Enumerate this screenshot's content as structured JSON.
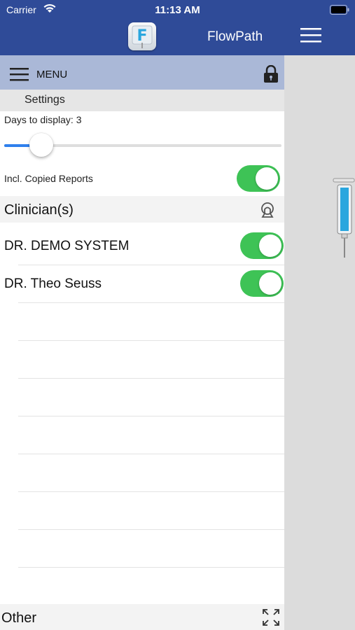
{
  "status": {
    "carrier": "Carrier",
    "time": "11:13 AM"
  },
  "header": {
    "title": "FlowPath",
    "logo_letter": "F"
  },
  "menu": {
    "label": "MENU"
  },
  "settings": {
    "section_title": "Settings",
    "days_label": "Days to display:",
    "days_value": "3",
    "days_slider_level": 0.13,
    "copied_reports_label": "Incl. Copied Reports",
    "copied_reports_on": true
  },
  "clinicians": {
    "title": "Clinician(s)",
    "items": [
      {
        "name": "DR. DEMO SYSTEM",
        "enabled": true
      },
      {
        "name": "DR. Theo Seuss",
        "enabled": true
      }
    ]
  },
  "other": {
    "title": "Other"
  },
  "colors": {
    "nav_blue": "#2f4b98",
    "menu_bar": "#aab8d7",
    "toggle_green": "#3ec356",
    "slider_blue": "#2f80ed"
  },
  "icons": [
    "wifi-icon",
    "battery-icon",
    "app-logo",
    "hamburger-icon",
    "lock-icon",
    "clinician-head-icon",
    "expand-icon",
    "syringe-icon"
  ]
}
